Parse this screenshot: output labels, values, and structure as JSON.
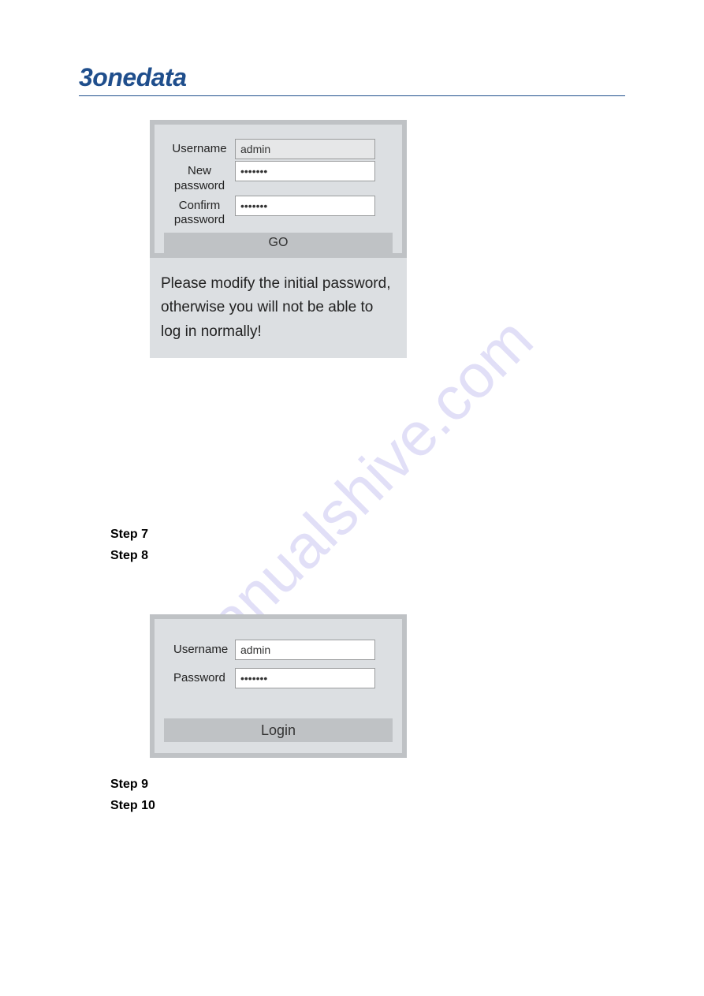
{
  "brand": "3onedata",
  "modify_form": {
    "username_label": "Username",
    "username_value": "admin",
    "new_password_label": "New password",
    "new_password_value": "•••••••",
    "confirm_password_label": "Confirm password",
    "confirm_password_value": "•••••••",
    "go_label": "GO"
  },
  "warning_text": "Please modify the initial password, otherwise you will not be able to log in normally!",
  "steps_upper": {
    "step7": "Step 7",
    "step8": "Step 8"
  },
  "login_form": {
    "username_label": "Username",
    "username_value": "admin",
    "password_label": "Password",
    "password_value": "•••••••",
    "login_label": "Login"
  },
  "steps_lower": {
    "step9": "Step 9",
    "step10": "Step 10"
  },
  "watermark": "manualshive.com"
}
